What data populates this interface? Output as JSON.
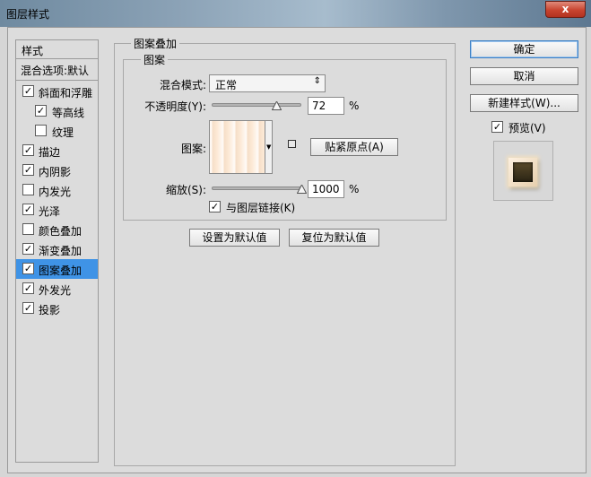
{
  "window": {
    "title": "图层样式",
    "close_glyph": "x"
  },
  "style_list": {
    "header": "样式",
    "blend_options": "混合选项:默认",
    "items": [
      {
        "label": "斜面和浮雕",
        "checked": true,
        "indent": false,
        "selected": false
      },
      {
        "label": "等高线",
        "checked": true,
        "indent": true,
        "selected": false
      },
      {
        "label": "纹理",
        "checked": false,
        "indent": true,
        "selected": false
      },
      {
        "label": "描边",
        "checked": true,
        "indent": false,
        "selected": false
      },
      {
        "label": "内阴影",
        "checked": true,
        "indent": false,
        "selected": false
      },
      {
        "label": "内发光",
        "checked": false,
        "indent": false,
        "selected": false
      },
      {
        "label": "光泽",
        "checked": true,
        "indent": false,
        "selected": false
      },
      {
        "label": "颜色叠加",
        "checked": false,
        "indent": false,
        "selected": false
      },
      {
        "label": "渐变叠加",
        "checked": true,
        "indent": false,
        "selected": false
      },
      {
        "label": "图案叠加",
        "checked": true,
        "indent": false,
        "selected": true
      },
      {
        "label": "外发光",
        "checked": true,
        "indent": false,
        "selected": false
      },
      {
        "label": "投影",
        "checked": true,
        "indent": false,
        "selected": false
      }
    ]
  },
  "panel": {
    "title": "图案叠加",
    "group_title": "图案",
    "blend_mode": {
      "label": "混合模式:",
      "value": "正常",
      "arrow": "⇕"
    },
    "opacity": {
      "label": "不透明度(Y):",
      "value": "72",
      "unit": "%",
      "level": 0.72
    },
    "pattern": {
      "label": "图案:",
      "snap_button": "贴紧原点(A)"
    },
    "scale": {
      "label": "缩放(S):",
      "value": "1000",
      "unit": "%",
      "level": 1.0
    },
    "link_with_layer": {
      "label": "与图层链接(K)",
      "checked": true
    },
    "make_default": "设置为默认值",
    "reset_default": "复位为默认值"
  },
  "actions": {
    "ok": "确定",
    "cancel": "取消",
    "new_style": "新建样式(W)...",
    "preview": {
      "label": "预览(V)",
      "checked": true
    }
  },
  "colors": {
    "selected_row": "#3f93e6",
    "dialog_bg": "#dcdcdc",
    "close_button": "#c8442f"
  }
}
